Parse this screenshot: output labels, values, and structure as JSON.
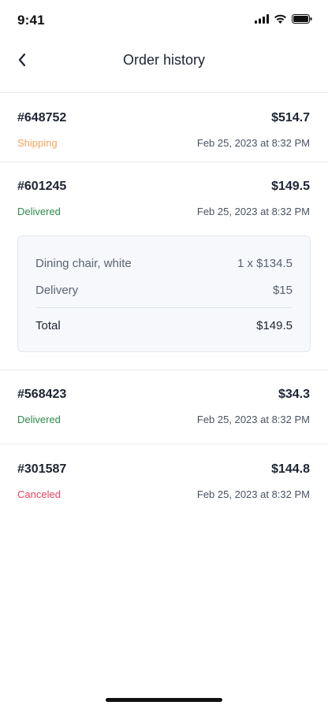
{
  "status_bar": {
    "time": "9:41"
  },
  "header": {
    "title": "Order history"
  },
  "colors": {
    "shipping": "#f5a35c",
    "delivered": "#2e8b4f",
    "canceled": "#e8455b"
  },
  "orders": [
    {
      "id": "#648752",
      "total": "$514.7",
      "status": "Shipping",
      "date": "Feb 25, 2023 at 8:32 PM"
    },
    {
      "id": "#601245",
      "total": "$149.5",
      "status": "Delivered",
      "date": "Feb 25, 2023 at 8:32 PM"
    },
    {
      "id": "#568423",
      "total": "$34.3",
      "status": "Delivered",
      "date": "Feb 25, 2023 at 8:32 PM"
    },
    {
      "id": "#301587",
      "total": "$144.8",
      "status": "Canceled",
      "date": "Feb 25, 2023 at 8:32 PM"
    }
  ],
  "order_details": {
    "item_name": "Dining chair, white",
    "item_value": "1 x $134.5",
    "delivery_label": "Delivery",
    "delivery_value": "$15",
    "total_label": "Total",
    "total_value": "$149.5"
  }
}
